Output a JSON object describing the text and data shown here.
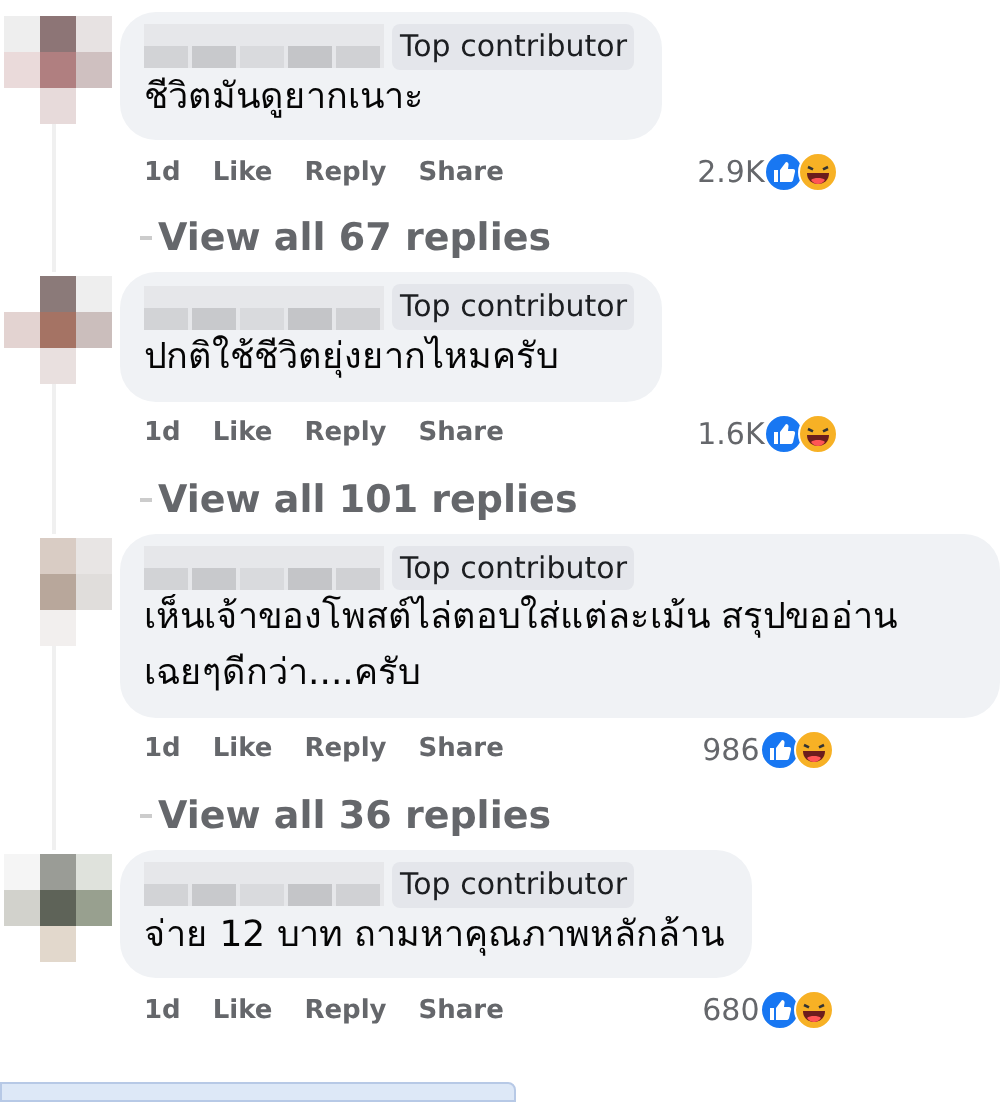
{
  "comments": [
    {
      "badge": "Top contributor",
      "text": "ชีวิตมันดูยากเนาะ",
      "time": "1d",
      "actions": [
        "Like",
        "Reply",
        "Share"
      ],
      "reaction_count": "2.9K",
      "replies_link": "View all 67 replies"
    },
    {
      "badge": "Top contributor",
      "text": "ปกติใช้ชีวิตยุ่งยากไหมครับ",
      "time": "1d",
      "actions": [
        "Like",
        "Reply",
        "Share"
      ],
      "reaction_count": "1.6K",
      "replies_link": "View all 101 replies"
    },
    {
      "badge": "Top contributor",
      "text": "เห็นเจ้าของโพสต์ไล่ตอบใส่แต่ละเม้น สรุปขออ่านเฉยๆดีกว่า....ครับ",
      "time": "1d",
      "actions": [
        "Like",
        "Reply",
        "Share"
      ],
      "reaction_count": "986",
      "replies_link": "View all 36 replies"
    },
    {
      "badge": "Top contributor",
      "text": "จ่าย 12 บาท ถามหาคุณภาพหลักล้าน",
      "time": "1d",
      "actions": [
        "Like",
        "Reply",
        "Share"
      ],
      "reaction_count": "680"
    }
  ]
}
